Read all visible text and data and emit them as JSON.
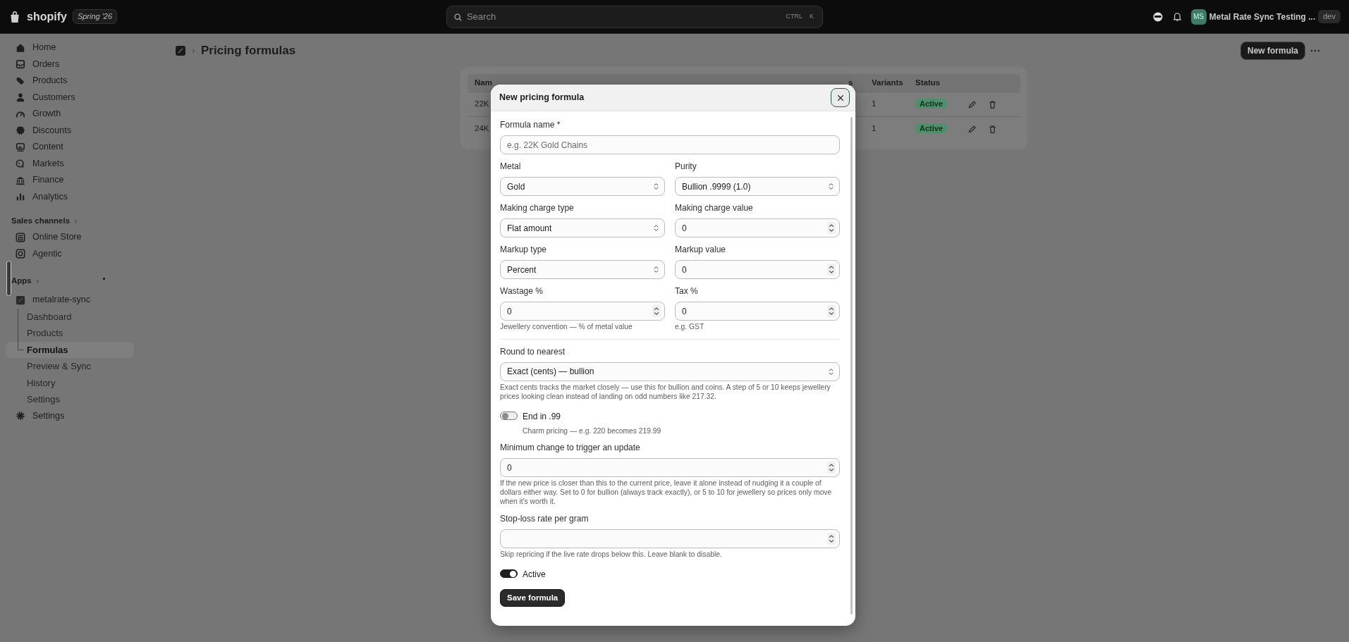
{
  "topbar": {
    "logo_text": "shopify",
    "edition": "Spring '26",
    "search": {
      "placeholder": "Search",
      "shortcut": [
        "CTRL",
        "K"
      ]
    },
    "store": {
      "initials": "MS",
      "name": "Metal Rate Sync Testing ...",
      "badge": "dev"
    }
  },
  "sidebar": {
    "items": [
      {
        "label": "Home",
        "kind": "home"
      },
      {
        "label": "Orders",
        "kind": "inbox"
      },
      {
        "label": "Products",
        "kind": "tag"
      },
      {
        "label": "Customers",
        "kind": "person"
      },
      {
        "label": "Growth",
        "kind": "gauge"
      },
      {
        "label": "Discounts",
        "kind": "discount"
      },
      {
        "label": "Content",
        "kind": "image"
      },
      {
        "label": "Markets",
        "kind": "globe"
      },
      {
        "label": "Finance",
        "kind": "bank"
      },
      {
        "label": "Analytics",
        "kind": "bars"
      }
    ],
    "sales_channels": {
      "heading": "Sales channels",
      "items": [
        {
          "label": "Online Store",
          "kind": "store"
        },
        {
          "label": "Agentic",
          "kind": "robot"
        }
      ]
    },
    "apps": {
      "heading": "Apps",
      "app": {
        "name": "metalrate-sync",
        "items": [
          {
            "label": "Dashboard",
            "selected": false
          },
          {
            "label": "Products",
            "selected": false
          },
          {
            "label": "Formulas",
            "selected": true
          },
          {
            "label": "Preview & Sync",
            "selected": false
          },
          {
            "label": "History",
            "selected": false
          },
          {
            "label": "Settings",
            "selected": false
          }
        ]
      }
    },
    "settings": "Settings"
  },
  "page": {
    "title": "Pricing formulas",
    "primary_button": "New formula"
  },
  "table": {
    "columns": [
      "Nam",
      "s",
      "Variants",
      "Status"
    ],
    "rows": [
      {
        "name": "22K",
        "variants": "1",
        "status": "Active"
      },
      {
        "name": "24K",
        "variants": "1",
        "status": "Active"
      }
    ]
  },
  "modal": {
    "title": "New pricing formula",
    "items": [
      {
        "kind": "fields",
        "fields": [
          {
            "label": "Formula name *",
            "kind": "text",
            "placeholder": "e.g. 22K Gold Chains"
          }
        ]
      },
      {
        "kind": "fields",
        "fields": [
          {
            "label": "Metal",
            "kind": "select",
            "value": "Gold"
          },
          {
            "label": "Purity",
            "kind": "select",
            "value": "Bullion .9999 (1.0)"
          }
        ]
      },
      {
        "kind": "fields",
        "fields": [
          {
            "label": "Making charge type",
            "kind": "select",
            "value": "Flat amount"
          },
          {
            "label": "Making charge value",
            "kind": "number",
            "value": "0"
          }
        ]
      },
      {
        "kind": "fields",
        "fields": [
          {
            "label": "Markup type",
            "kind": "select",
            "value": "Percent"
          },
          {
            "label": "Markup value",
            "kind": "number",
            "value": "0"
          }
        ]
      },
      {
        "kind": "fields",
        "fields": [
          {
            "label": "Wastage %",
            "kind": "number",
            "value": "0",
            "help": "Jewellery convention — % of metal value"
          },
          {
            "label": "Tax %",
            "kind": "number",
            "value": "0",
            "help": "e.g. GST"
          }
        ]
      },
      {
        "kind": "divider"
      },
      {
        "kind": "fields",
        "fields": [
          {
            "label": "Round to nearest",
            "kind": "select",
            "value": "Exact (cents) — bullion",
            "help": "Exact cents tracks the market closely — use this for bullion and coins. A step of 5 or 10 keeps jewellery prices looking clean instead of landing on odd numbers like 217.32."
          }
        ]
      },
      {
        "kind": "toggle",
        "label": "End in .99",
        "on": false,
        "help": "Charm pricing — e.g. 220 becomes 219.99"
      },
      {
        "kind": "fields",
        "fields": [
          {
            "label": "Minimum change to trigger an update",
            "kind": "number",
            "value": "0",
            "help": "If the new price is closer than this to the current price, leave it alone instead of nudging it a couple of dollars either way. Set to 0 for bullion (always track exactly), or 5 to 10 for jewellery so prices only move when it's worth it."
          }
        ]
      },
      {
        "kind": "fields",
        "fields": [
          {
            "label": "Stop-loss rate per gram",
            "kind": "number",
            "help": "Skip repricing if the live rate drops below this. Leave blank to disable."
          }
        ]
      },
      {
        "kind": "toggle",
        "label": "Active",
        "on": true
      }
    ],
    "save_button": "Save formula"
  }
}
